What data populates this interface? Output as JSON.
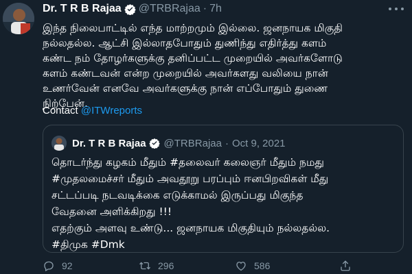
{
  "tweet": {
    "author_name": "Dr. T R B Rajaa",
    "author_handle": "@TRBRajaa",
    "separator": "·",
    "time": "7h",
    "text": "இந்த நிலைபாட்டில் எந்த மாற்றமும் இல்லை. ஜனநாயக மிகுதி\nநல்லதல்ல. ஆட்சி இல்லாதபோதும் துணிந்து எதிர்த்து களம்\nகண்ட நம் தோழர்களுக்கு தனிப்பட்ட முறையில் அவர்களோடு\nகளம் கண்டவன் என்ற முறையில் அவர்களது வலியை நான்\nஉணர்வேன் எனவே அவர்களுக்கு நான் எப்போதும் துணை\nநிற்பேன்.",
    "contact_label": "Contact",
    "contact_mention": "@ITWreports"
  },
  "quoted": {
    "author_name": "Dr. T R B Rajaa",
    "author_handle": "@TRBRajaa",
    "separator": "·",
    "date": "Oct 9, 2021",
    "text": "தொடர்ந்து கழகம் மீதும் #தலைவர் கலைஞர் மீதும் நமது\n#முதலமைச்சர் மீதும் அவதூறு பரப்பும் ஈனபிறவிகள் மீது\nசட்டப்படி நடவடிக்கை எடுக்காமல் இருப்பது மிகுந்த\nவேதனை அளிக்கிறது !!!\nஎதற்கும் அளவு உண்டு... ஜனநாயக மிகுதியும் நல்லதல்ல.\n#திமுக #Dmk"
  },
  "actions": {
    "reply_count": "92",
    "retweet_count": "296",
    "like_count": "586"
  },
  "icons": {
    "verified": "verified-badge-icon",
    "more": "more-options-icon",
    "reply": "reply-icon",
    "retweet": "retweet-icon",
    "like": "like-icon",
    "share": "share-icon"
  },
  "colors": {
    "background": "#15202b",
    "text": "#ffffff",
    "secondary": "#8899a6",
    "accent": "#1d9bf0",
    "border": "#38444d"
  }
}
